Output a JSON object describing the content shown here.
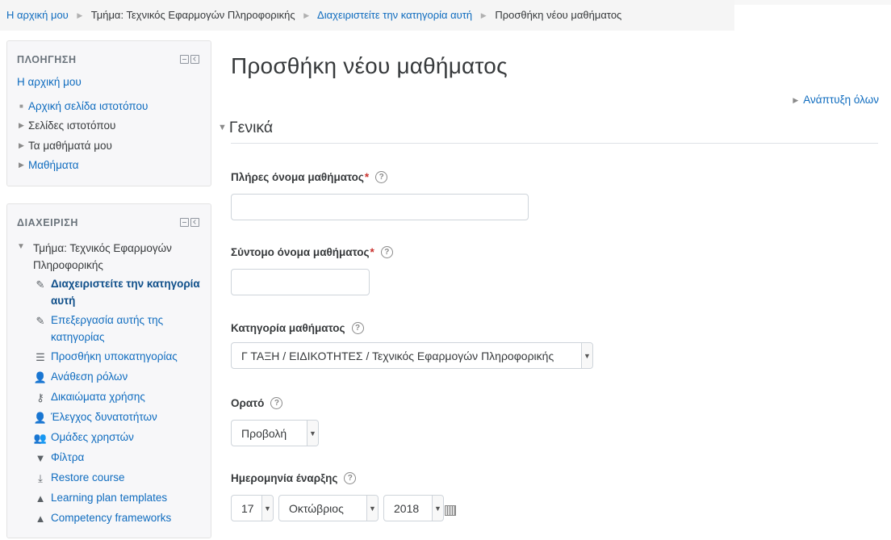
{
  "breadcrumb": {
    "home": "Η αρχική μου",
    "department": "Τμήμα: Τεχνικός Εφαρμογών Πληροφορικής",
    "manage": "Διαχειριστείτε την κατηγορία αυτή",
    "current": "Προσθήκη νέου μαθήματος"
  },
  "navigation": {
    "title": "ΠΛΟΗΓΗΣΗ",
    "home": "Η αρχική μου",
    "items": [
      {
        "label": "Αρχική σελίδα ιστοτόπου",
        "type": "bullet"
      },
      {
        "label": "Σελίδες ιστοτόπου",
        "type": "collapsed"
      },
      {
        "label": "Τα μαθήματά μου",
        "type": "collapsed"
      },
      {
        "label": "Μαθήματα",
        "type": "collapsed"
      }
    ]
  },
  "administration": {
    "title": "ΔΙΑΧΕΙΡΙΣΗ",
    "section": "Τμήμα: Τεχνικός Εφαρμογών Πληροφορικής",
    "items": [
      {
        "label": "Διαχειριστείτε την κατηγορία αυτή",
        "icon": "pencil-icon",
        "active": true
      },
      {
        "label": "Επεξεργασία αυτής της κατηγορίας",
        "icon": "pencil-icon"
      },
      {
        "label": "Προσθήκη υποκατηγορίας",
        "icon": "subcategory-icon"
      },
      {
        "label": "Ανάθεση ρόλων",
        "icon": "user-role-icon"
      },
      {
        "label": "Δικαιώματα χρήσης",
        "icon": "key-icon"
      },
      {
        "label": "Έλεγχος δυνατοτήτων",
        "icon": "user-check-icon"
      },
      {
        "label": "Ομάδες χρηστών",
        "icon": "users-icon"
      },
      {
        "label": "Φίλτρα",
        "icon": "filter-icon"
      },
      {
        "label": "Restore course",
        "icon": "restore-icon"
      },
      {
        "label": "Learning plan templates",
        "icon": "learning-plan-icon"
      },
      {
        "label": "Competency frameworks",
        "icon": "competency-icon"
      }
    ]
  },
  "main": {
    "title": "Προσθήκη νέου μαθήματος",
    "expand_all": "Ανάπτυξη όλων",
    "section": "Γενικά",
    "fields": {
      "fullname_label": "Πλήρες όνομα μαθήματος",
      "fullname_value": "",
      "shortname_label": "Σύντομο όνομα μαθήματος",
      "shortname_value": "",
      "category_label": "Κατηγορία μαθήματος",
      "category_value": "Γ ΤΑΞΗ / ΕΙΔΙΚΟΤΗΤΕΣ / Τεχνικός Εφαρμογών Πληροφορικής",
      "visible_label": "Ορατό",
      "visible_value": "Προβολή",
      "startdate_label": "Ημερομηνία έναρξης",
      "start_day": "17",
      "start_month": "Οκτώβριος",
      "start_year": "2018"
    },
    "required_mark": "*",
    "help_glyph": "?"
  },
  "colors": {
    "link": "#0f6cbf",
    "required": "#c9302c",
    "block_bg": "#f7f7f9"
  }
}
